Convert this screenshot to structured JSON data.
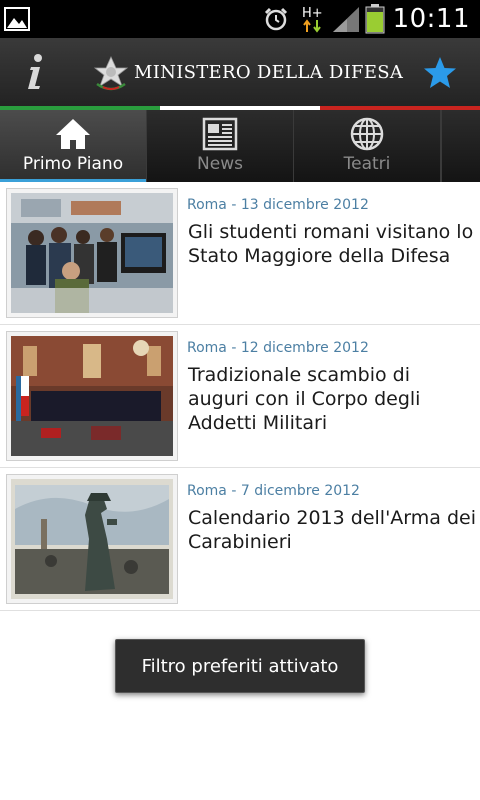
{
  "status_bar": {
    "time": "10:11",
    "icons": [
      "gallery-icon",
      "alarm-icon",
      "hplus-data-icon",
      "signal-icon",
      "battery-icon"
    ],
    "network_label": "H+",
    "battery_color": "#9acd32"
  },
  "header": {
    "title": "MINISTERO DELLA DIFESA",
    "info_icon": "info-icon",
    "emblem_icon": "italian-emblem-icon",
    "favorite_icon": "star-icon",
    "star_color": "#2b9bea"
  },
  "tricolor": [
    "#2a9d3e",
    "#ffffff",
    "#c9241f"
  ],
  "tabs": [
    {
      "label": "Primo Piano",
      "icon": "home-icon",
      "active": true
    },
    {
      "label": "News",
      "icon": "newspaper-icon",
      "active": false
    },
    {
      "label": "Teatri",
      "icon": "globe-icon",
      "active": false
    }
  ],
  "accent_color": "#3aa0d8",
  "news": [
    {
      "meta": "Roma - 13 dicembre 2012",
      "title": "Gli studenti romani visitano lo Stato Maggiore della Difesa",
      "thumb": "students-control-room-photo"
    },
    {
      "meta": "Roma - 12 dicembre 2012",
      "title": "Tradizionale scambio di auguri con il Corpo degli Addetti Militari",
      "thumb": "ceremony-hall-photo"
    },
    {
      "meta": "Roma - 7 dicembre 2012",
      "title": "Calendario 2013 dell'Arma dei Carabinieri",
      "thumb": "carabiniere-statue-photo"
    }
  ],
  "toast": {
    "text": "Filtro preferiti attivato"
  }
}
